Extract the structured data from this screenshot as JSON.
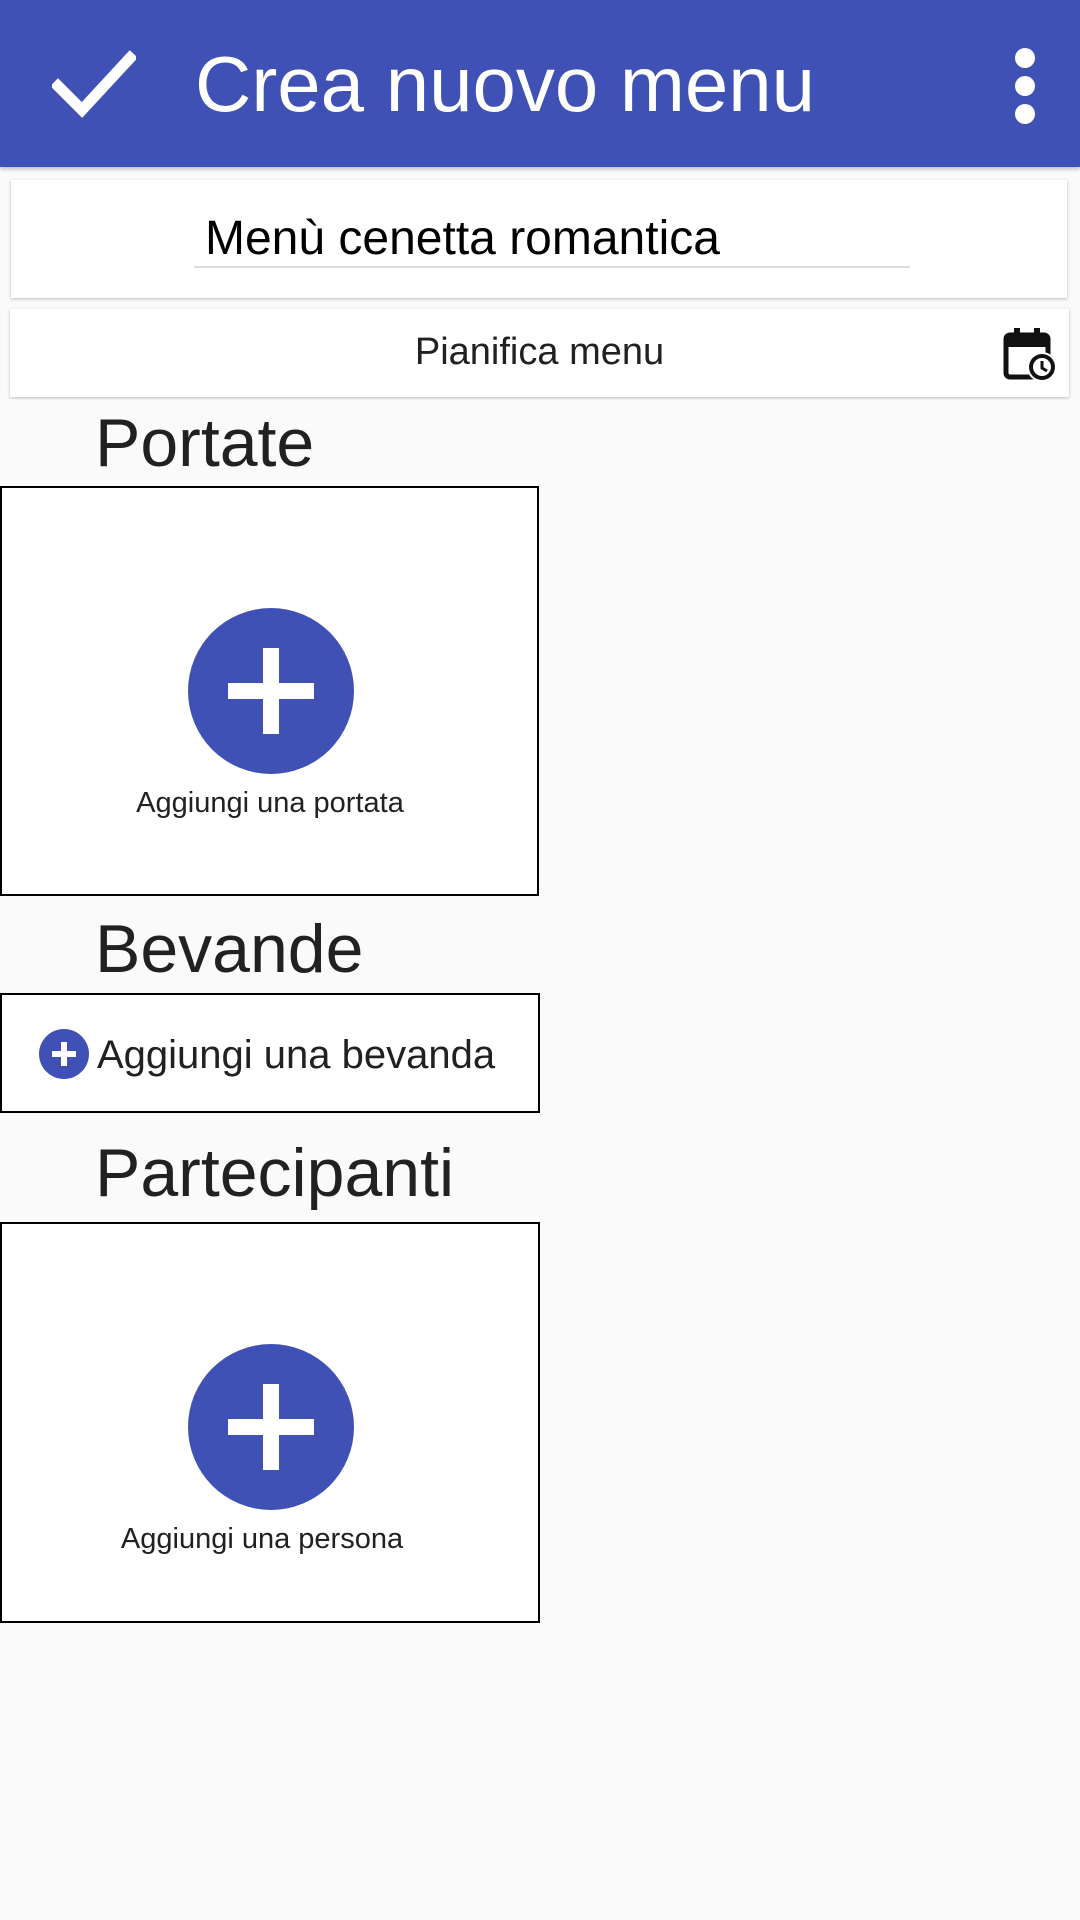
{
  "app_bar": {
    "title": "Crea nuovo menu",
    "confirm_icon": "check-icon",
    "more_icon": "more-vert-icon",
    "color": "#3f51b5"
  },
  "menu_name": {
    "value": "Menù cenetta romantica"
  },
  "schedule": {
    "label": "Pianifica menu",
    "icon": "calendar-clock-icon"
  },
  "sections": {
    "courses": {
      "title": "Portate",
      "add_label": "Aggiungi una portata"
    },
    "drinks": {
      "title": "Bevande",
      "add_label": "Aggiungi una bevanda"
    },
    "participants": {
      "title": "Partecipanti",
      "add_label": "Aggiungi una persona"
    }
  }
}
